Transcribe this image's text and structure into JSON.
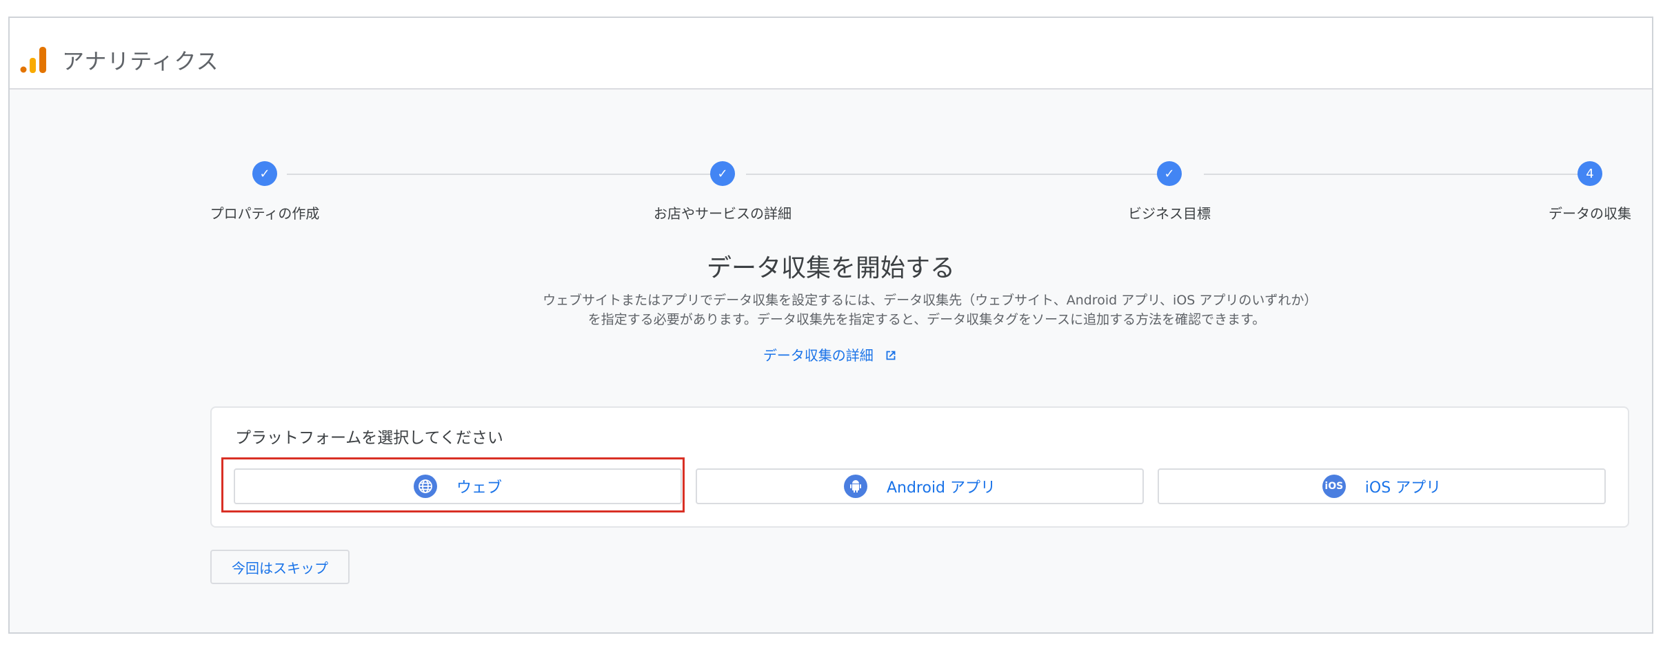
{
  "app": {
    "title": "アナリティクス"
  },
  "stepper": {
    "steps": [
      {
        "label": "プロパティの作成",
        "state": "done",
        "marker": "✓"
      },
      {
        "label": "お店やサービスの詳細",
        "state": "done",
        "marker": "✓"
      },
      {
        "label": "ビジネス目標",
        "state": "done",
        "marker": "✓"
      },
      {
        "label": "データの収集",
        "state": "current",
        "marker": "4"
      }
    ]
  },
  "main": {
    "heading": "データ収集を開始する",
    "description": "ウェブサイトまたはアプリでデータ収集を設定するには、データ収集先（ウェブサイト、Android アプリ、iOS アプリのいずれか）を指定する必要があります。データ収集先を指定すると、データ収集タグをソースに追加する方法を確認できます。",
    "learn_more": "データ収集の詳細"
  },
  "platform": {
    "title": "プラットフォームを選択してください",
    "options": [
      {
        "label": "ウェブ",
        "icon": "globe-icon"
      },
      {
        "label": "Android アプリ",
        "icon": "android-icon"
      },
      {
        "label": "iOS アプリ",
        "icon": "ios-icon"
      }
    ]
  },
  "skip_label": "今回はスキップ",
  "colors": {
    "accent": "#1a73e8",
    "step": "#4285f4",
    "highlight": "#d93025",
    "logo_orange": "#f9ab00",
    "logo_dark": "#e37400"
  }
}
